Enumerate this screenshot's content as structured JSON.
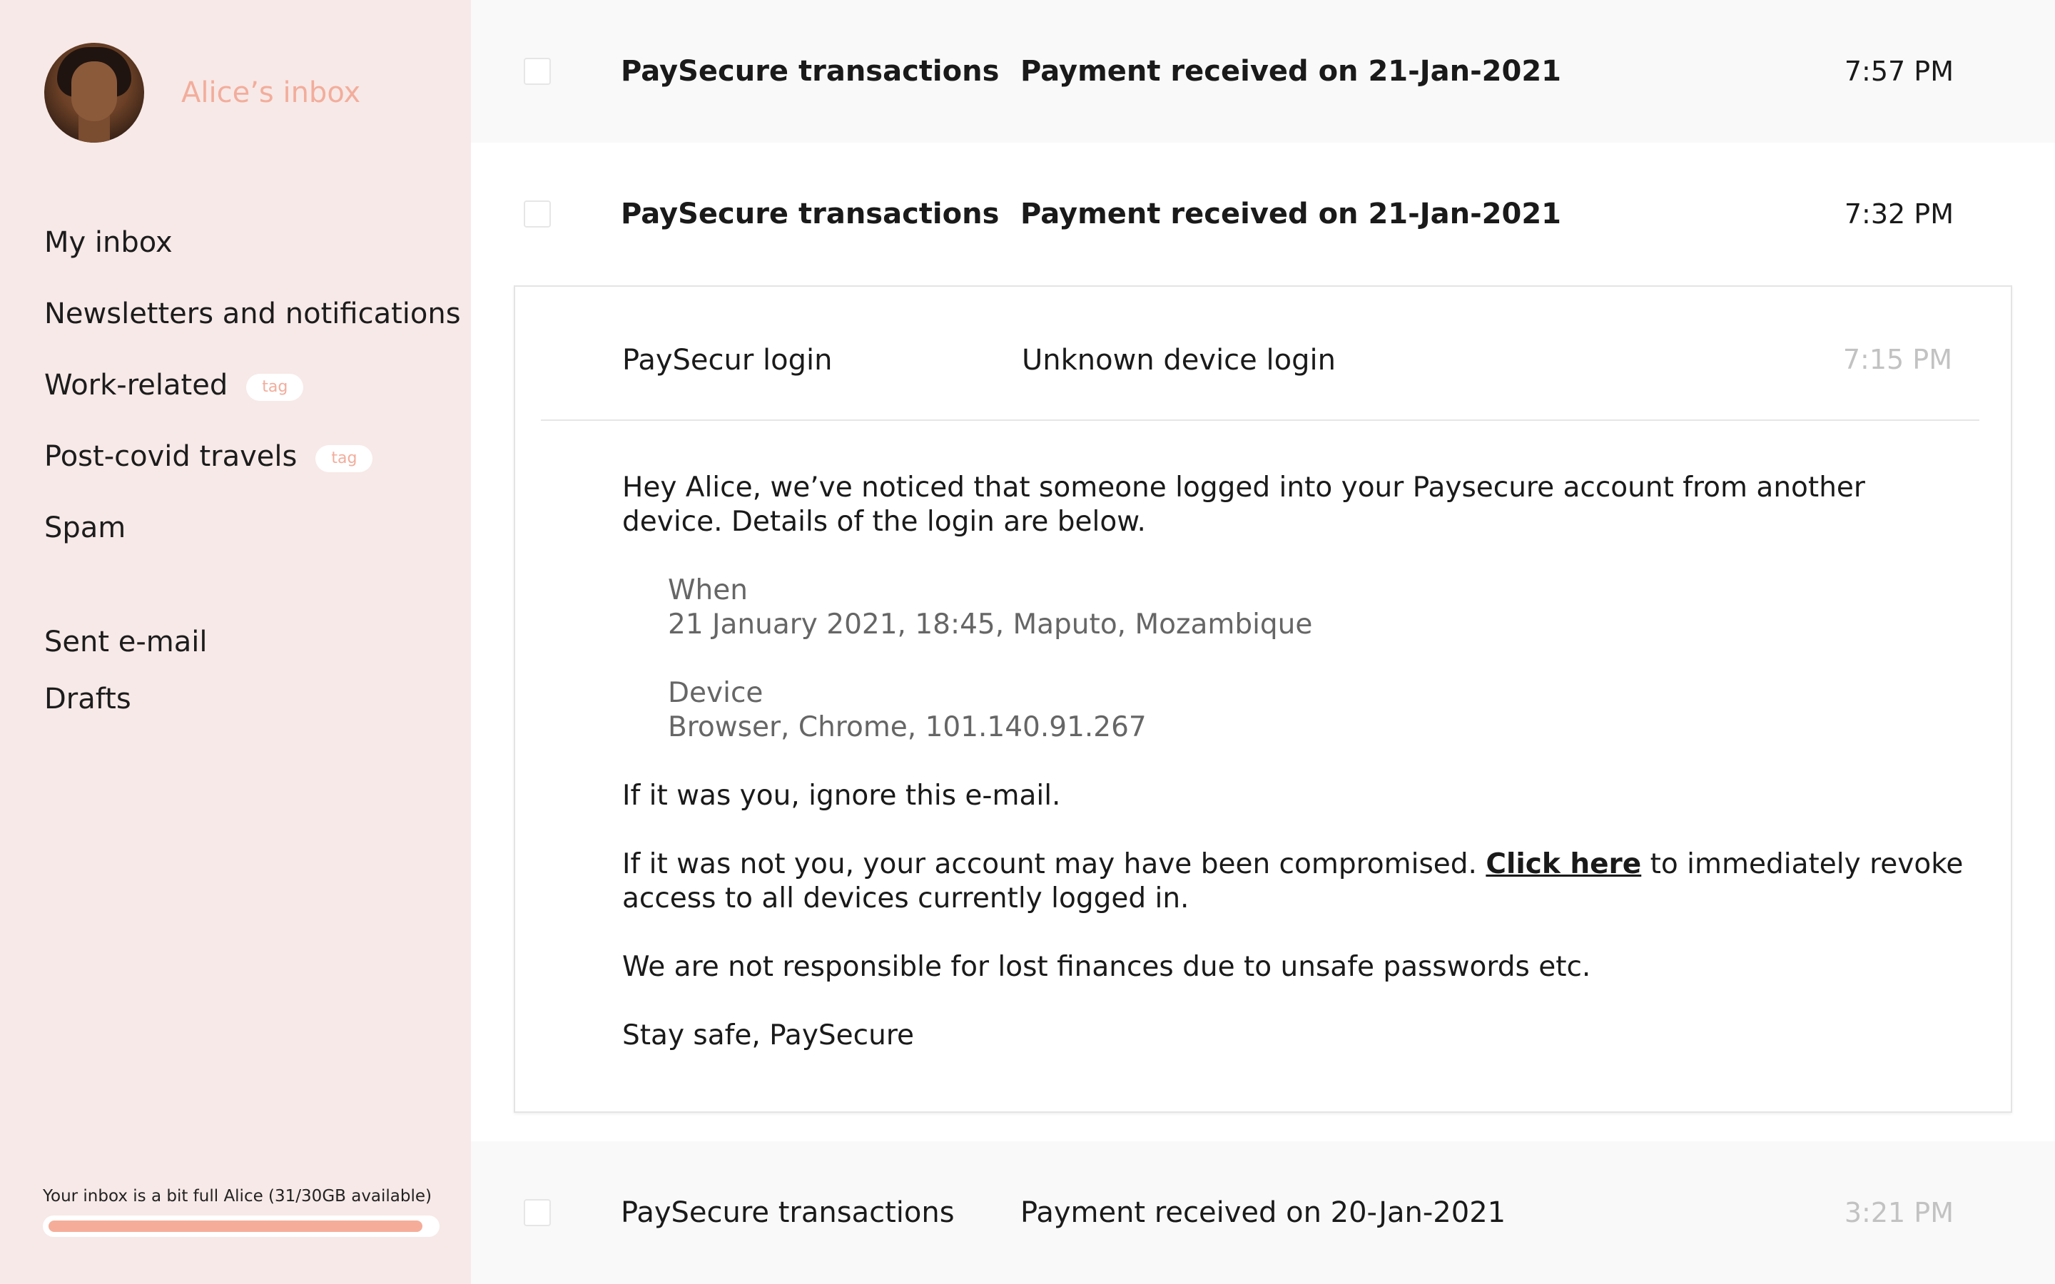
{
  "sidebar": {
    "title": "Alice’s inbox",
    "primary_items": [
      {
        "label": "My inbox"
      },
      {
        "label": "Newsletters and notifications"
      },
      {
        "label": "Work-related",
        "tag": "tag"
      },
      {
        "label": "Post-covid travels",
        "tag": "tag"
      },
      {
        "label": "Spam"
      }
    ],
    "secondary_items": [
      {
        "label": "Sent e-mail"
      },
      {
        "label": "Drafts"
      }
    ],
    "storage": {
      "text": "Your inbox is a bit full Alice (31/30GB available)",
      "fill_fraction": 0.97
    }
  },
  "emails": [
    {
      "sender": "PaySecure transactions",
      "subject": "Payment received on 21-Jan-2021",
      "time": "7:57 PM",
      "unread": true
    },
    {
      "sender": "PaySecure transactions",
      "subject": "Payment received on 21-Jan-2021",
      "time": "7:32 PM",
      "unread": true
    },
    {
      "sender": "PaySecur login",
      "subject": "Unknown device login",
      "time": "7:15 PM",
      "unread": false,
      "expanded": true
    },
    {
      "sender": "PaySecure transactions",
      "subject": "Payment received on 20-Jan-2021",
      "time": "3:21 PM",
      "unread": false
    }
  ],
  "open_mail": {
    "intro": "Hey Alice, we’ve noticed that someone logged into your Paysecure account from another device. Details of the login are below.",
    "when_label": "When",
    "when_value": "21 January 2021, 18:45, Maputo, Mozambique",
    "device_label": "Device",
    "device_value": "Browser, Chrome, 101.140.91.267",
    "ignore_line": "If it was you, ignore this e-mail.",
    "compromised_before": "If it was not you, your account may have been compromised. ",
    "link_text": "Click here",
    "compromised_after": " to immediately revoke access to all devices currently logged in.",
    "disclaimer": "We are not responsible for lost finances due to unsafe passwords etc.",
    "signoff": "Stay safe, PaySecure"
  },
  "colors": {
    "sidebar_bg": "#f7e9e7",
    "accent": "#f2ad9c",
    "storage_fill": "#f5ad99"
  }
}
